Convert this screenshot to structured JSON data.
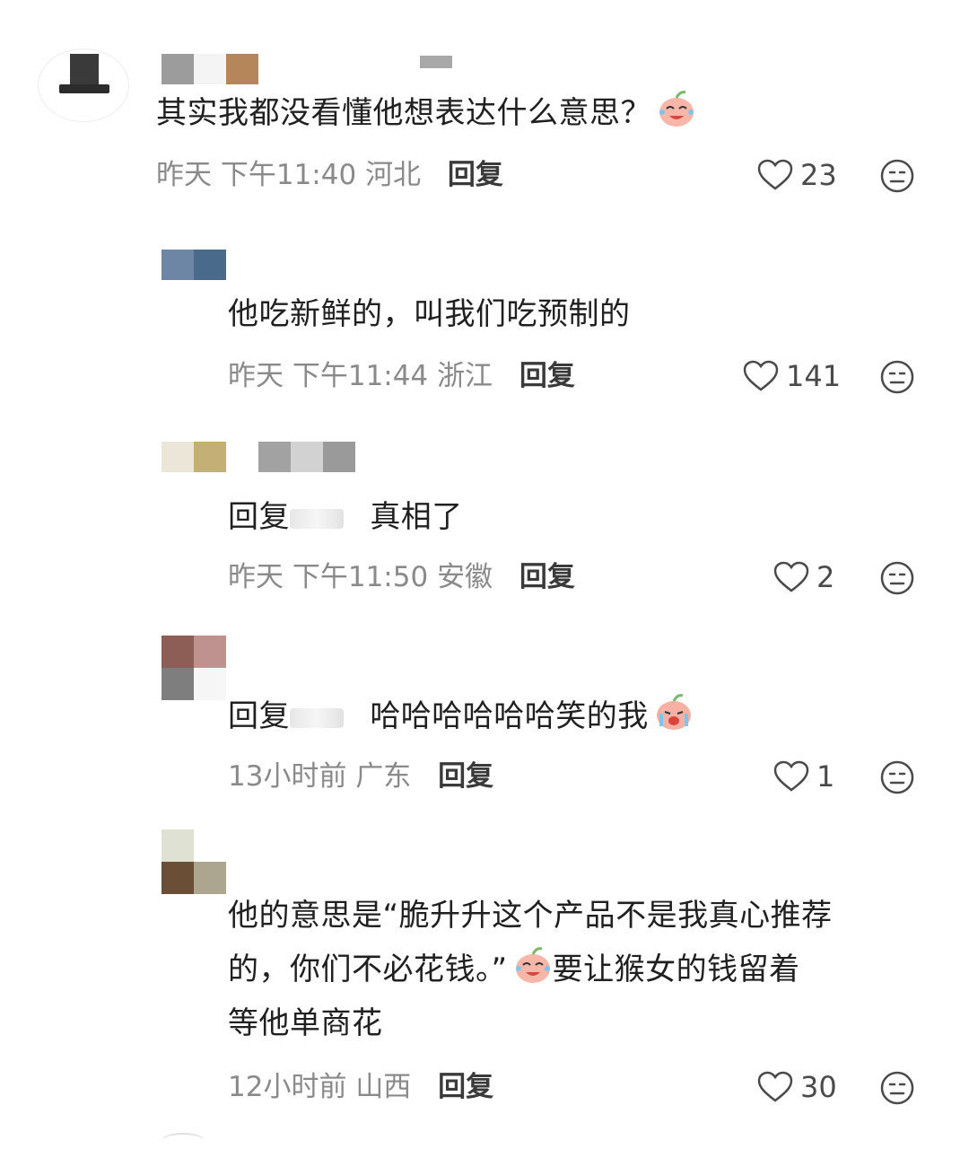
{
  "comments": [
    {
      "text": "其实我都没看懂他想表达什么意思？",
      "emoji": "laugh-cry-peach-emoji",
      "time": "昨天 下午11:40",
      "location": "河北",
      "reply": "回复",
      "likes": "23"
    },
    {
      "text": "他吃新鲜的，叫我们吃预制的",
      "time": "昨天 下午11:44",
      "location": "浙江",
      "reply": "回复",
      "likes": "141"
    },
    {
      "prefix": "回复",
      "text": "真相了",
      "time": "昨天 下午11:50",
      "location": "安徽",
      "reply": "回复",
      "likes": "2"
    },
    {
      "prefix": "回复",
      "text": "哈哈哈哈哈哈笑的我",
      "emoji": "crying-peach-emoji",
      "time": "13小时前",
      "location": "广东",
      "reply": "回复",
      "likes": "1"
    },
    {
      "line1": "他的意思是“脆升升这个产品不是我真心推荐",
      "line2a": "的，你们不必花钱。”",
      "line2b": "要让猴女的钱留着",
      "line3": "等他单商花",
      "emoji": "laugh-cry-peach-emoji",
      "time": "12小时前",
      "location": "山西",
      "reply": "回复",
      "likes": "30"
    }
  ],
  "colors": {
    "text": "#202020",
    "meta": "#8a8a8a",
    "icon": "#4a4a4a"
  }
}
